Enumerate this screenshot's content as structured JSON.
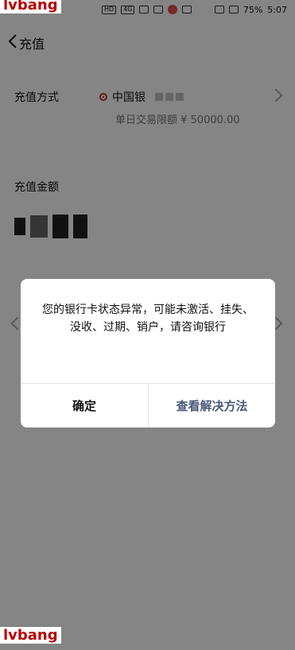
{
  "status_bar": {
    "battery": "75%",
    "time": "5:07",
    "left_badges": [
      "HD",
      "4G"
    ]
  },
  "nav": {
    "title": "充值"
  },
  "recharge_method": {
    "label": "充值方式",
    "bank_name": "中国银",
    "limit": "单日交易限额 ¥ 50000.00"
  },
  "recharge_amount": {
    "label": "充值金额"
  },
  "dialog": {
    "message": "您的银行卡状态异常，可能未激活、挂失、没收、过期、销户，请咨询银行",
    "confirm_label": "确定",
    "solution_label": "查看解决方法"
  },
  "watermark": {
    "text": "lvbang"
  },
  "colors": {
    "overlay": "#00000080",
    "dialog_link": "#4a5b7a",
    "watermark": "#b90000"
  }
}
